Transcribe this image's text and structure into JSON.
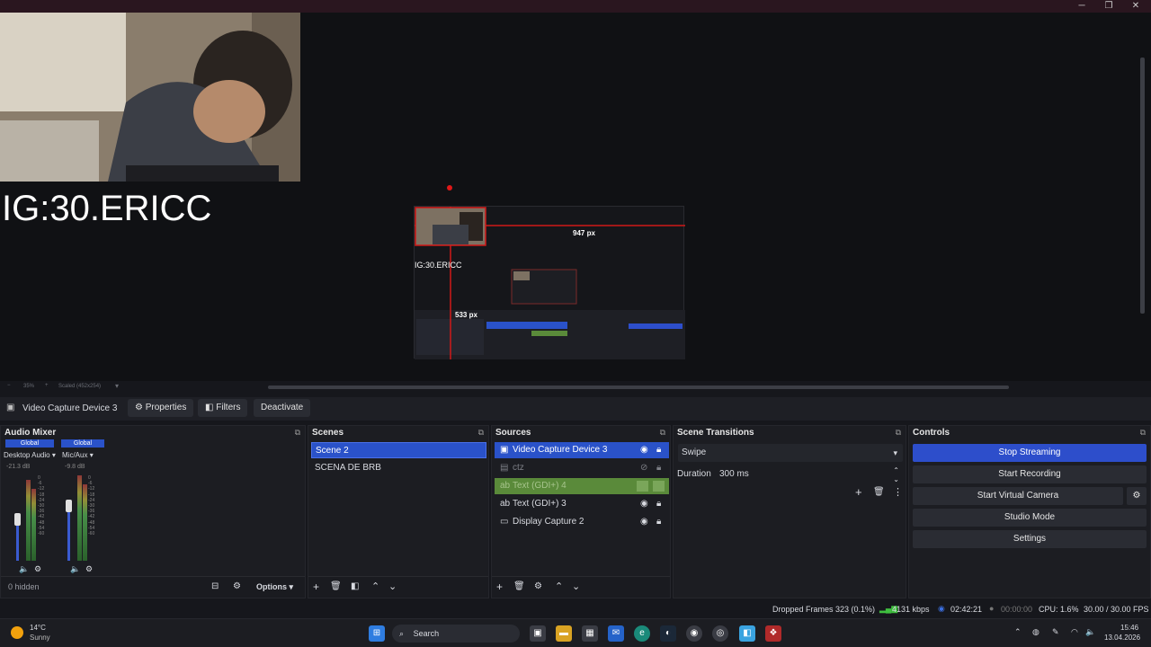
{
  "window": {
    "controls": [
      "─",
      "❐",
      "✕"
    ]
  },
  "preview": {
    "overlay_text": "IG:30.ERICC",
    "mini_overlay_text": "IG:30.ERICC",
    "width_label": "947 px",
    "height_label": "533 px"
  },
  "zoombar": {
    "minus": "−",
    "zoom": "35%",
    "plus": "+",
    "scale": "Scaled (452x254)"
  },
  "context": {
    "source_name": "Video Capture Device 3",
    "properties": "Properties",
    "filters": "Filters",
    "deactivate": "Deactivate"
  },
  "audio_mixer": {
    "title": "Audio Mixer",
    "channels": [
      {
        "scope": "Global",
        "name": "Desktop Audio",
        "db": "-21.3 dB"
      },
      {
        "scope": "Global",
        "name": "Mic/Aux",
        "db": "-9.8 dB"
      }
    ],
    "scale": [
      "0",
      "-6",
      "-12",
      "-18",
      "-24",
      "-30",
      "-36",
      "-42",
      "-48",
      "-54",
      "-60"
    ],
    "hidden": "0 hidden",
    "options": "Options"
  },
  "scenes": {
    "title": "Scenes",
    "items": [
      "Scene 2",
      "SCENA DE BRB"
    ]
  },
  "sources": {
    "title": "Sources",
    "items": [
      "Video Capture Device 3",
      "ctz",
      "Text (GDI+) 4",
      "Text (GDI+) 3",
      "Display Capture 2"
    ]
  },
  "transitions": {
    "title": "Scene Transitions",
    "type": "Swipe",
    "duration_label": "Duration",
    "duration_value": "300 ms"
  },
  "controls": {
    "title": "Controls",
    "stop_streaming": "Stop Streaming",
    "start_recording": "Start Recording",
    "start_virtual_camera": "Start Virtual Camera",
    "studio_mode": "Studio Mode",
    "settings": "Settings"
  },
  "status": {
    "dropped_frames": "Dropped Frames 323 (0.1%)",
    "bitrate": "4131 kbps",
    "stream_time": "02:42:21",
    "rec_time": "00:00:00",
    "cpu": "CPU: 1.6%",
    "fps": "30.00 / 30.00 FPS"
  },
  "taskbar": {
    "weather_temp": "14°C",
    "weather_desc": "Sunny",
    "search": "Search",
    "time": "15:46",
    "date": "13.04.2026"
  },
  "colors": {
    "accent": "#2d4ecb",
    "selected_row": "#2a52c9",
    "green_row": "#5a8a3a",
    "titlebar": "#2a161f"
  }
}
